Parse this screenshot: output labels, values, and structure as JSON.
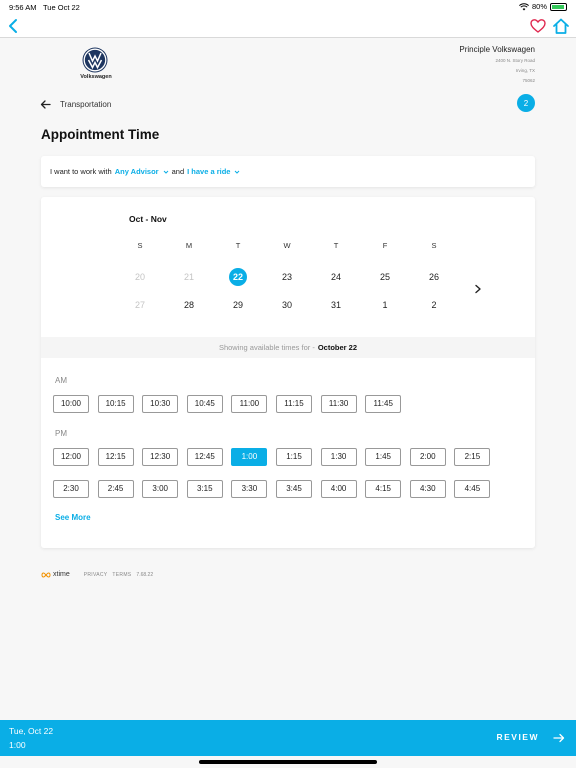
{
  "status_bar": {
    "time": "9:56 AM",
    "date": "Tue Oct 22",
    "battery": "80%"
  },
  "dealer": {
    "brand_label": "Volkswagen",
    "name": "Principle Volkswagen",
    "address_1": "2400 N. Story Road",
    "address_2": "Irving, TX",
    "address_3": "75062"
  },
  "breadcrumb": {
    "label": "Transportation",
    "step": "2"
  },
  "page_title": "Appointment Time",
  "prefs": {
    "prefix": "I want to work with",
    "advisor": "Any Advisor",
    "and": "and",
    "ride": "I have a ride"
  },
  "calendar": {
    "month": "Oct - Nov",
    "weekdays": [
      "S",
      "M",
      "T",
      "W",
      "T",
      "F",
      "S"
    ],
    "weeks": [
      [
        {
          "d": "20",
          "state": "disabled"
        },
        {
          "d": "21",
          "state": "disabled"
        },
        {
          "d": "22",
          "state": "selected"
        },
        {
          "d": "23",
          "state": "normal"
        },
        {
          "d": "24",
          "state": "normal"
        },
        {
          "d": "25",
          "state": "normal"
        },
        {
          "d": "26",
          "state": "normal"
        }
      ],
      [
        {
          "d": "27",
          "state": "disabled"
        },
        {
          "d": "28",
          "state": "normal"
        },
        {
          "d": "29",
          "state": "normal"
        },
        {
          "d": "30",
          "state": "normal"
        },
        {
          "d": "31",
          "state": "normal"
        },
        {
          "d": "1",
          "state": "normal"
        },
        {
          "d": "2",
          "state": "normal"
        }
      ]
    ]
  },
  "showing": {
    "prefix": "Showing available times for -",
    "date": "October 22"
  },
  "am_label": "AM",
  "pm_label": "PM",
  "am_slots": [
    "10:00",
    "10:15",
    "10:30",
    "10:45",
    "11:00",
    "11:15",
    "11:30",
    "11:45"
  ],
  "pm_slots_row1": [
    "12:00",
    "12:15",
    "12:30",
    "12:45",
    "1:00",
    "1:15",
    "1:30",
    "1:45",
    "2:00",
    "2:15"
  ],
  "pm_slots_row2": [
    "2:30",
    "2:45",
    "3:00",
    "3:15",
    "3:30",
    "3:45",
    "4:00",
    "4:15",
    "4:30",
    "4:45"
  ],
  "selected_slot": "1:00",
  "see_more": "See More",
  "footer": {
    "brand": "xtime",
    "privacy": "PRIVACY",
    "terms": "TERMS",
    "version": "7.68.22"
  },
  "bottom": {
    "date": "Tue, Oct 22",
    "time": "1:00",
    "review": "REVIEW"
  },
  "colors": {
    "accent": "#0aaee6",
    "heart": "#e0284f"
  }
}
